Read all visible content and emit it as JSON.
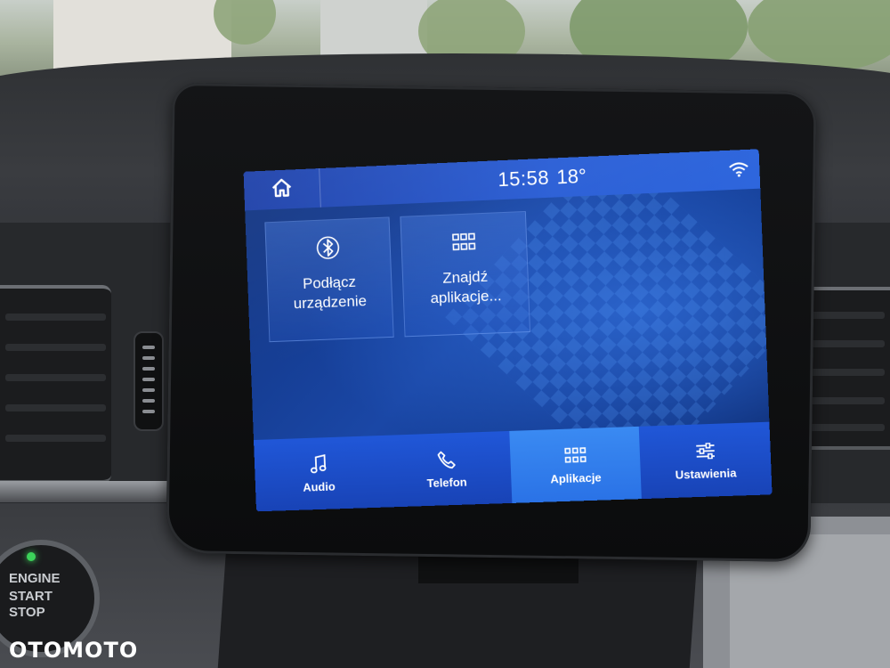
{
  "status_bar": {
    "time": "15:58",
    "temperature": "18°",
    "icons": [
      "home-icon",
      "wifi-icon"
    ]
  },
  "tiles": [
    {
      "label_line1": "Podłącz",
      "label_line2": "urządzenie",
      "icon": "bluetooth-icon"
    },
    {
      "label_line1": "Znajdź",
      "label_line2": "aplikacje...",
      "icon": "apps-grid-icon"
    }
  ],
  "bottom_nav": [
    {
      "label": "Audio",
      "icon": "music-note-icon",
      "active": false
    },
    {
      "label": "Telefon",
      "icon": "phone-icon",
      "active": false
    },
    {
      "label": "Aplikacje",
      "icon": "apps-grid-icon",
      "active": true
    },
    {
      "label": "Ustawienia",
      "icon": "sliders-icon",
      "active": false
    }
  ],
  "dashboard": {
    "start_button_line1": "ENGINE",
    "start_button_line2": "START",
    "start_button_line3": "STOP"
  },
  "watermark": "OTOMOTO",
  "colors": {
    "screen_blue": "#1a4bc8",
    "active_tab": "#2a72e6",
    "text": "#ffffff",
    "led_green": "#3cd35a"
  }
}
